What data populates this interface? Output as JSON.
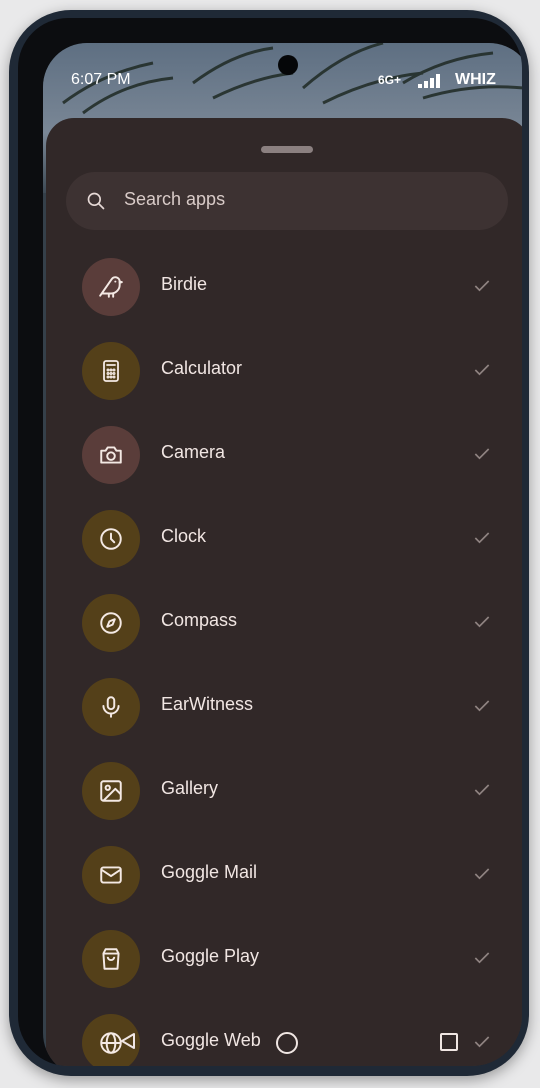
{
  "status_bar": {
    "time": "6:07 PM",
    "network": "6G+",
    "carrier": "WHIZ"
  },
  "search": {
    "placeholder": "Search apps",
    "icon": "search-icon"
  },
  "apps": [
    {
      "label": "Birdie",
      "icon": "bird-icon",
      "color": "#5a3d3a",
      "checked": true
    },
    {
      "label": "Calculator",
      "icon": "calculator-icon",
      "color": "#544019",
      "checked": true
    },
    {
      "label": "Camera",
      "icon": "camera-icon",
      "color": "#5a3d3a",
      "checked": true
    },
    {
      "label": "Clock",
      "icon": "clock-icon",
      "color": "#544019",
      "checked": true
    },
    {
      "label": "Compass",
      "icon": "compass-icon",
      "color": "#544019",
      "checked": true
    },
    {
      "label": "EarWitness",
      "icon": "microphone-icon",
      "color": "#544019",
      "checked": true
    },
    {
      "label": "Gallery",
      "icon": "image-icon",
      "color": "#544019",
      "checked": true
    },
    {
      "label": "Goggle Mail",
      "icon": "mail-icon",
      "color": "#544019",
      "checked": true
    },
    {
      "label": "Goggle Play",
      "icon": "shopping-bag-icon",
      "color": "#544019",
      "checked": true
    },
    {
      "label": "Goggle Web",
      "icon": "globe-icon",
      "color": "#544019",
      "checked": true
    }
  ],
  "colors": {
    "sheet": "#312828",
    "search_bg": "#3d3232",
    "text": "#f1e6e3",
    "check": "#8f8381",
    "icon_stroke": "#f4e9e4"
  },
  "nav_bar": {
    "back": "back-icon",
    "home": "home-icon",
    "recents": "recents-icon"
  }
}
